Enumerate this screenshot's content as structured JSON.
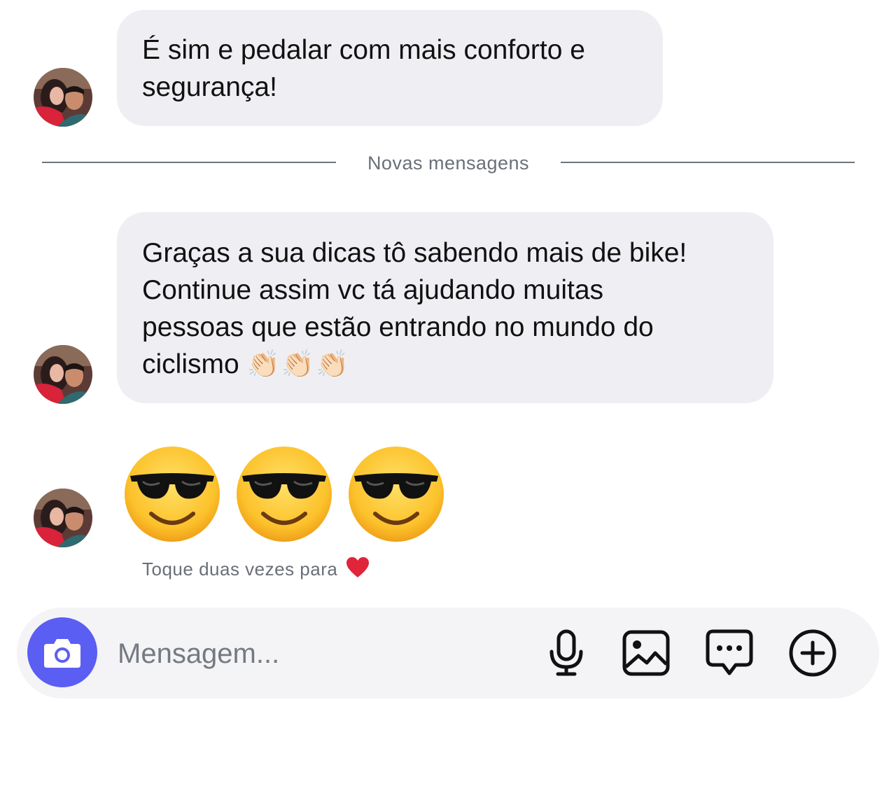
{
  "messages": [
    {
      "lines": [
        "É sim e pedalar com mais conforto e",
        "segurança!"
      ]
    },
    {
      "lines": [
        "Graças a sua dicas tô sabendo mais de bike!",
        "Continue assim vc tá ajudando muitas",
        "pessoas que estão entrando no mundo do",
        "ciclismo"
      ],
      "trailing_emoji": "👏🏻👏🏻👏🏻"
    }
  ],
  "divider": {
    "label": "Novas mensagens"
  },
  "emoji_message": {
    "emoji": [
      "sunglasses-face",
      "sunglasses-face",
      "sunglasses-face"
    ]
  },
  "hint": {
    "text": "Toque duas vezes para",
    "icon": "heart"
  },
  "composer": {
    "placeholder": "Mensagem...",
    "icons": [
      "camera-icon",
      "microphone-icon",
      "image-icon",
      "chat-bubble-icon",
      "plus-circle-icon"
    ]
  },
  "colors": {
    "bubble": "#efeff3",
    "camera_button": "#5b5ef2",
    "composer": "#f4f4f6",
    "secondary_text": "#6a6f78",
    "heart": "#e0243a"
  }
}
